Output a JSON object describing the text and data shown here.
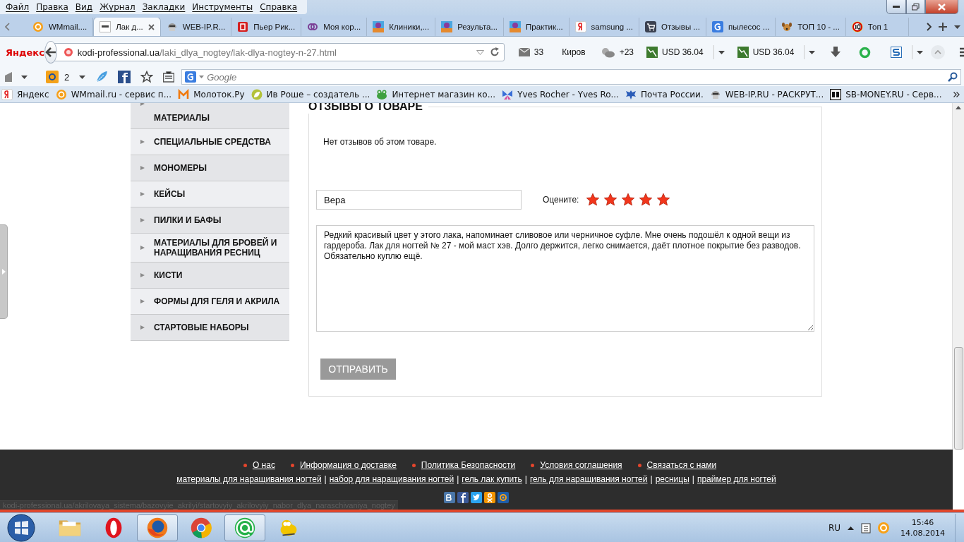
{
  "menu": [
    "Файл",
    "Правка",
    "Вид",
    "Журнал",
    "Закладки",
    "Инструменты",
    "Справка"
  ],
  "tabs": [
    {
      "title": "WMmail....",
      "kind": "wmmail",
      "selected": false
    },
    {
      "title": "Лак д...",
      "kind": "kodi",
      "selected": true
    },
    {
      "title": "WEB-IP.R...",
      "kind": "robot",
      "selected": false
    },
    {
      "title": "Пьер Рик...",
      "kind": "doc",
      "selected": false
    },
    {
      "title": "Моя кор...",
      "kind": "rings",
      "selected": false
    },
    {
      "title": "Клиники,...",
      "kind": "photo",
      "selected": false
    },
    {
      "title": "Результа...",
      "kind": "photo",
      "selected": false
    },
    {
      "title": "Практик...",
      "kind": "photo",
      "selected": false
    },
    {
      "title": "samsung ...",
      "kind": "yandex",
      "selected": false
    },
    {
      "title": "Отзывы ...",
      "kind": "cart",
      "selected": false
    },
    {
      "title": "пылесос ...",
      "kind": "google",
      "selected": false
    },
    {
      "title": "ТОП 10 - ...",
      "kind": "dog",
      "selected": false
    },
    {
      "title": "Топ 1",
      "kind": "ten",
      "selected": false
    }
  ],
  "navbar": {
    "logo": "Яндекс",
    "url_host": "kodi-professional.ua",
    "url_path": "/laki_dlya_nogtey/lak-dlya-nogtey-n-27.html",
    "mail_count": "33",
    "city": "Киров",
    "temperature": "+23",
    "rates": [
      "USD 36.04",
      "USD 36.04"
    ]
  },
  "toolbar": {
    "mail_badge": "2",
    "search": {
      "placeholder": "Google"
    }
  },
  "bookmarks": [
    {
      "title": "Яндекс",
      "kind": "yandex"
    },
    {
      "title": "WMmail.ru - сервис п...",
      "kind": "wmmail"
    },
    {
      "title": "Молоток.Ру",
      "kind": "molotok"
    },
    {
      "title": "Ив Роше – создатель ...",
      "kind": "leaf"
    },
    {
      "title": "Интернет магазин ко...",
      "kind": "frog"
    },
    {
      "title": "Yves Rocher - Yves Ro...",
      "kind": "butterfly"
    },
    {
      "title": "Почта России.",
      "kind": "eagle"
    },
    {
      "title": "WEB-IP.RU - РАСКРУТ...",
      "kind": "robot"
    },
    {
      "title": "SB-MONEY.RU - Серв...",
      "kind": "sb"
    }
  ],
  "sidebar": {
    "items": [
      "МАТЕРИАЛЫ",
      "СПЕЦИАЛЬНЫЕ СРЕДСТВА",
      "МОНОМЕРЫ",
      "КЕЙСЫ",
      "ПИЛКИ И БАФЫ",
      "МАТЕРИАЛЫ ДЛЯ БРОВЕЙ И НАРАЩИВАНИЯ РЕСНИЦ",
      "КИСТИ",
      "ФОРМЫ ДЛЯ ГЕЛЯ И АКРИЛА",
      "СТАРТОВЫЕ НАБОРЫ"
    ]
  },
  "review": {
    "heading": "ОТЗЫВЫ О ТОВАРЕ",
    "empty_text": "Нет отзывов об этом товаре.",
    "name_value": "Вера",
    "rating_label": "Оцените:",
    "stars": 5,
    "text_value": "Редкий красивый цвет у этого лака, напоминает сливовое или черничное суфле. Мне очень подошёл к одной вещи из гардероба. Лак для ногтей № 27 - мой маст хэв. Долго держится, легко снимается, даёт плотное покрытие без разводов. Обязательно куплю ещё.",
    "submit": "ОТПРАВИТЬ"
  },
  "footer": {
    "main_links": [
      "О нас",
      "Информация о доставке",
      "Политика Безопасности",
      "Условия соглашения",
      "Связаться с нами"
    ],
    "seo_links": [
      "материалы для наращивания ногтей",
      "набор для наращивания ногтей",
      "гель лак купить",
      "гель для наращивания ногтей",
      "ресницы",
      "праймер для ногтей"
    ],
    "separator": "|"
  },
  "status_url": "kodi-professional.ua/akrilovaya_sistema/bazovyie_akrilyi/startovyiy_akrilovyiy_nabor_dlya_naraschivaniya_nogtey",
  "taskbar": {
    "apps": [
      {
        "kind": "folder",
        "active": false
      },
      {
        "kind": "opera",
        "active": false
      },
      {
        "kind": "firefox",
        "active": true
      },
      {
        "kind": "chrome",
        "active": false
      },
      {
        "kind": "mailagent",
        "active": true
      },
      {
        "kind": "bird",
        "active": false
      }
    ],
    "language": "RU",
    "time": "15:46",
    "date": "14.08.2014"
  }
}
